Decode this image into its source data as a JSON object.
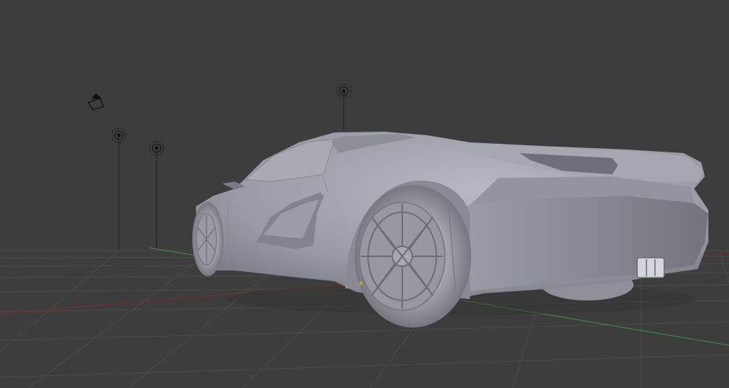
{
  "viewport": {
    "background": "#3d3d3d",
    "grid_color": "#4a4a4a",
    "x_axis_color": "#8a2d2d",
    "y_axis_color": "#3f8a3f"
  },
  "objects": {
    "camera": "camera-icon",
    "lamps": [
      "lamp-icon",
      "lamp-icon",
      "lamp-icon"
    ],
    "model": "sports-car-mesh"
  }
}
